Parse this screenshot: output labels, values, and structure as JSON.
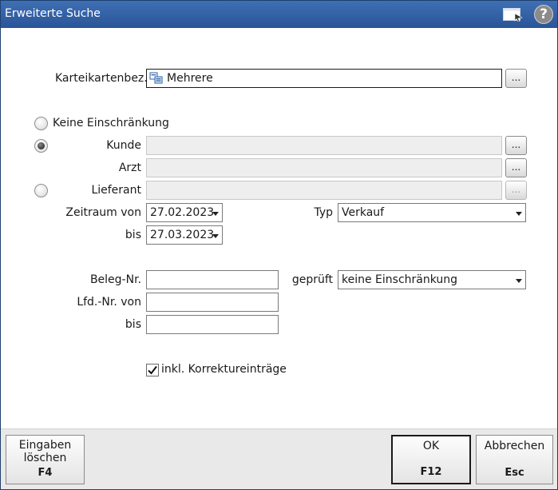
{
  "window": {
    "title": "Erweiterte Suche"
  },
  "titlebar_icons": {
    "window": "window-switch-icon",
    "help": "help-icon",
    "help_glyph": "?"
  },
  "karteikarten": {
    "label": "Karteikartenbez.",
    "value": "Mehrere",
    "icon": "multiple-cards-icon",
    "button": "..."
  },
  "scope": {
    "none_label": "Keine Einschränkung",
    "kunde_label": "Kunde",
    "arzt_label": "Arzt",
    "lieferant_label": "Lieferant",
    "selected": "Kunde",
    "button": "..."
  },
  "zeitraum": {
    "von_label": "Zeitraum von",
    "von_value": "27.02.2023",
    "bis_label": "bis",
    "bis_value": "27.03.2023"
  },
  "typ": {
    "label": "Typ",
    "value": "Verkauf"
  },
  "beleg": {
    "label": "Beleg-Nr.",
    "value": ""
  },
  "geprueft": {
    "label": "geprüft",
    "value": "keine Einschränkung"
  },
  "lfd": {
    "von_label": "Lfd.-Nr. von",
    "von_value": "",
    "bis_label": "bis",
    "bis_value": ""
  },
  "korrektur": {
    "label": "inkl. Korrektureinträge",
    "checked": true
  },
  "footer": {
    "clear": {
      "line1": "Eingaben",
      "line2": "löschen",
      "key": "F4"
    },
    "ok": {
      "label": "OK",
      "key": "F12"
    },
    "cancel": {
      "label": "Abbrechen",
      "key": "Esc"
    }
  }
}
